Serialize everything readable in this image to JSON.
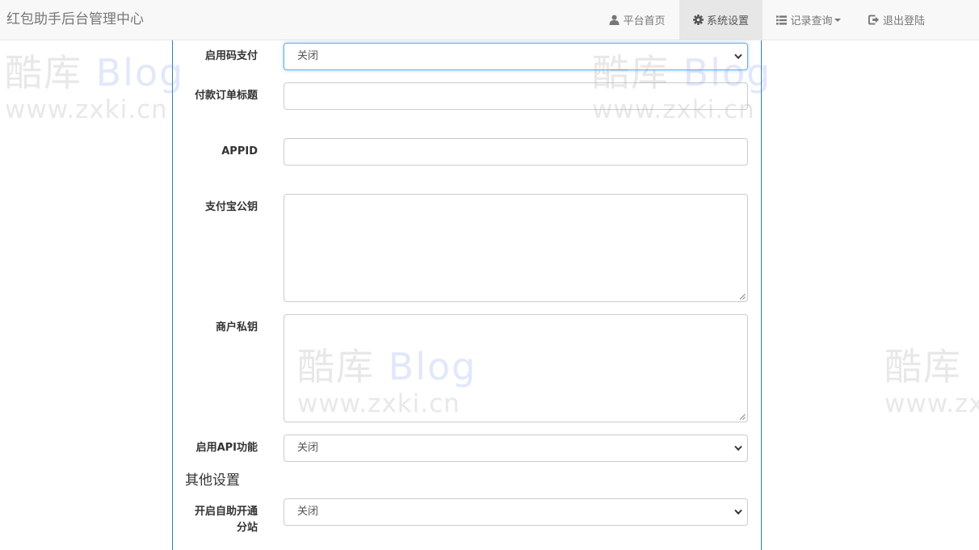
{
  "app": {
    "brand": "红包助手后台管理中心"
  },
  "nav": {
    "home": {
      "label": "平台首页",
      "icon": "user-icon"
    },
    "settings": {
      "label": "系统设置",
      "icon": "gear-icon",
      "active": true
    },
    "records": {
      "label": "记录查询",
      "icon": "list-icon"
    },
    "logout": {
      "label": "退出登陆",
      "icon": "logout-icon"
    }
  },
  "form": {
    "code_pay": {
      "label": "启用码支付",
      "value": "关闭"
    },
    "order_title": {
      "label": "付款订单标题",
      "value": ""
    },
    "appid": {
      "label": "APPID",
      "value": ""
    },
    "alipay_pubkey": {
      "label": "支付宝公钥",
      "value": ""
    },
    "merchant_privkey": {
      "label": "商户私钥",
      "value": ""
    },
    "api_enable": {
      "label": "启用API功能",
      "value": "关闭"
    }
  },
  "other": {
    "title": "其他设置",
    "self_substation": {
      "label": "开启自助开通分站",
      "value": "关闭"
    }
  },
  "watermark": {
    "logo_cn": "酷库",
    "logo_en": "Blog",
    "url": "www.zxki.cn"
  },
  "colors": {
    "accent": "#337ab7",
    "navbar_bg": "#f8f8f8",
    "nav_active_bg": "#e7e7e7"
  }
}
